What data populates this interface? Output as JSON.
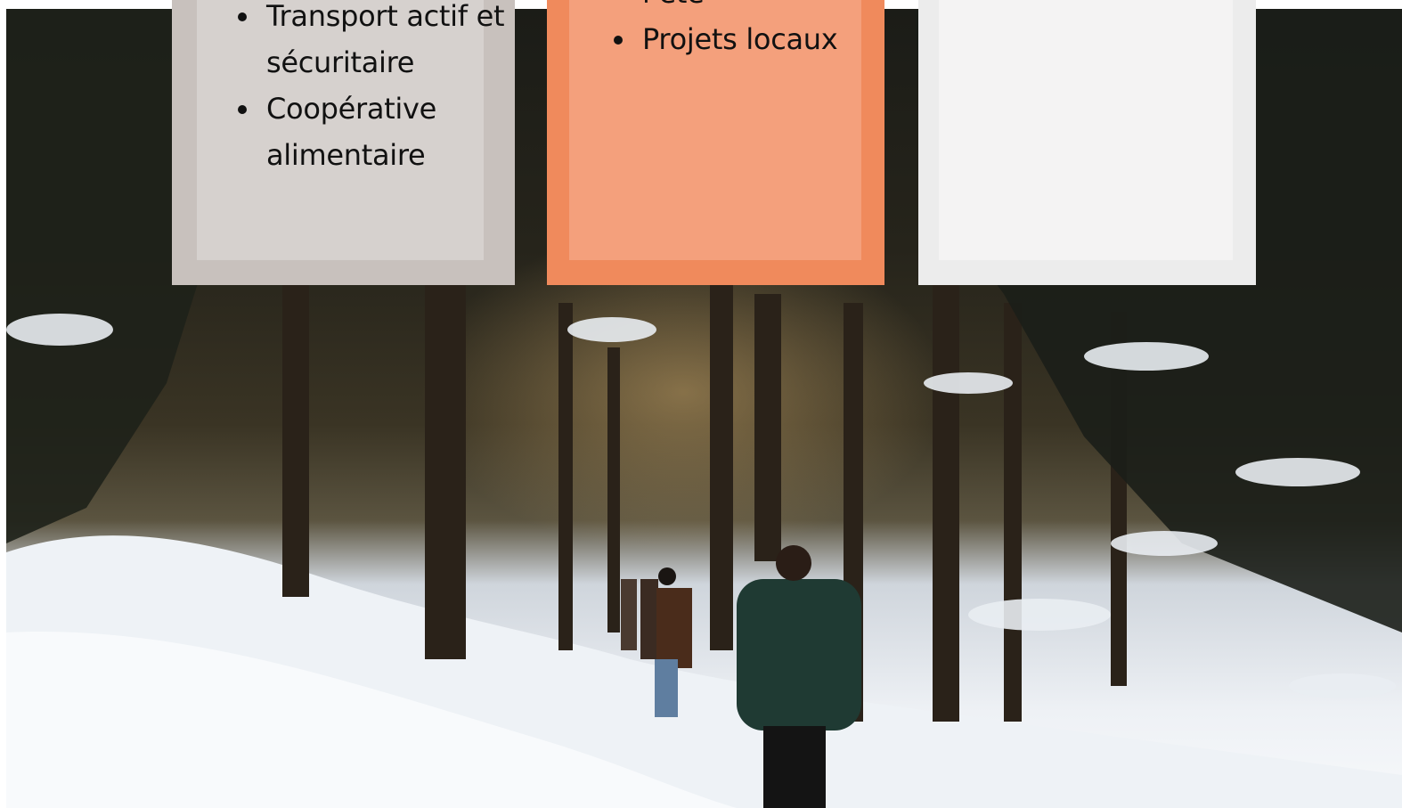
{
  "hero": {
    "icon": "forest-winter-photo"
  },
  "cards": [
    {
      "items": [
        "Transport actif et sécuritaire",
        "Coopérative alimentaire"
      ],
      "border_color": "#c8c1bd",
      "fill_color": "#d6d1ce"
    },
    {
      "items": [
        "l’été",
        "Projets locaux"
      ],
      "border_color": "#f08a5c",
      "fill_color": "#f4a07c"
    },
    {
      "items": [],
      "border_color": "#ececec",
      "fill_color": "#f4f3f3"
    }
  ]
}
